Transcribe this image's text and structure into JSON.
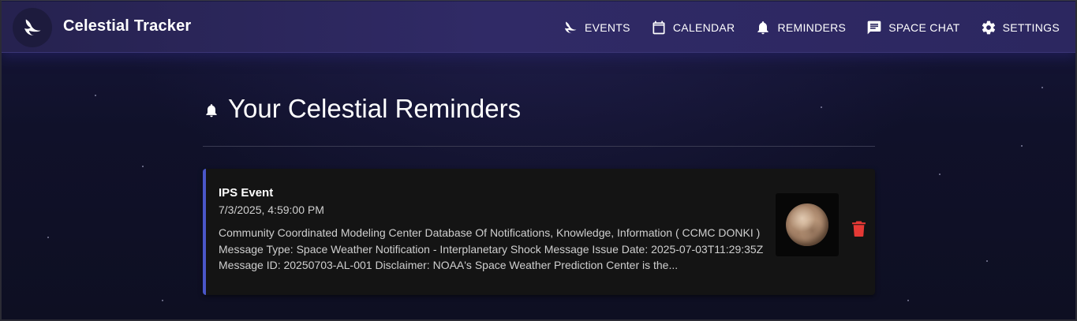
{
  "app": {
    "title": "Celestial Tracker"
  },
  "nav": {
    "items": [
      {
        "label": "EVENTS",
        "icon": "moon-icon"
      },
      {
        "label": "CALENDAR",
        "icon": "calendar-icon"
      },
      {
        "label": "REMINDERS",
        "icon": "bell-icon"
      },
      {
        "label": "SPACE CHAT",
        "icon": "chat-icon"
      },
      {
        "label": "SETTINGS",
        "icon": "gear-icon"
      }
    ]
  },
  "page": {
    "title": "Your Celestial Reminders",
    "title_icon": "bell-icon"
  },
  "reminders": [
    {
      "title": "IPS Event",
      "date": "7/3/2025, 4:59:00 PM",
      "description": "Community Coordinated Modeling Center Database Of Notifications, Knowledge, Information ( CCMC DONKI ) Message Type: Space Weather Notification - Interplanetary Shock Message Issue Date: 2025-07-03T11:29:35Z Message ID: 20250703-AL-001 Disclaimer: NOAA's Space Weather Prediction Center is the...",
      "thumbnail_icon": "planet-image",
      "delete_icon": "trash-icon"
    }
  ],
  "colors": {
    "appbar": "#2c2760",
    "background": "#0f1024",
    "card": "#141414",
    "card_accent": "#4a56c8",
    "delete": "#e53935"
  }
}
